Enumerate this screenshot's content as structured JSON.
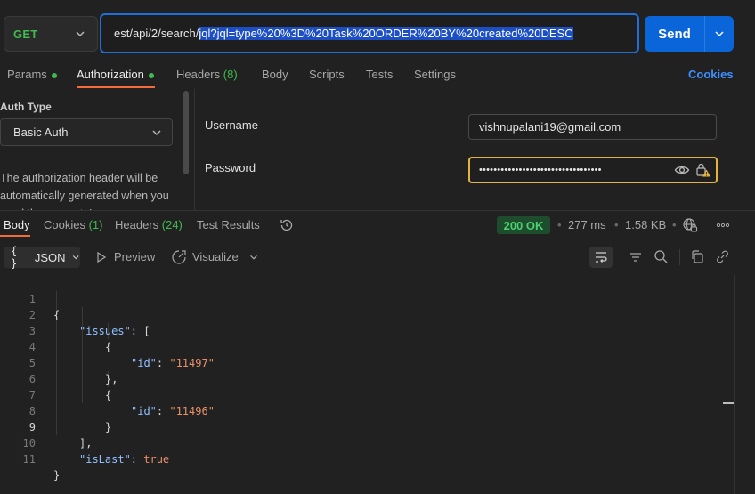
{
  "request": {
    "method": "GET",
    "url_prefix": "est/api/2/search/",
    "url_selected": "jql?jql=type%20%3D%20Task%20ORDER%20BY%20created%20DESC",
    "send_label": "Send"
  },
  "request_tabs": {
    "params": "Params",
    "authorization": "Authorization",
    "headers": "Headers",
    "headers_count": "(8)",
    "body": "Body",
    "scripts": "Scripts",
    "tests": "Tests",
    "settings": "Settings",
    "cookies": "Cookies"
  },
  "auth": {
    "type_label": "Auth Type",
    "type_value": "Basic Auth",
    "description": "The authorization header will be automatically generated when you send the request. Learn more",
    "username_label": "Username",
    "username_value": "vishnupalani19@gmail.com",
    "password_label": "Password",
    "password_value": "••••••••••••••••••••••••••••••••••"
  },
  "response_tabs": {
    "body": "Body",
    "cookies": "Cookies",
    "cookies_count": "(1)",
    "headers": "Headers",
    "headers_count": "(24)",
    "test_results": "Test Results"
  },
  "response_meta": {
    "status": "200 OK",
    "time": "277 ms",
    "size": "1.58 KB"
  },
  "body_toolbar": {
    "format": "JSON",
    "preview": "Preview",
    "visualize": "Visualize"
  },
  "code": {
    "line_numbers": [
      "1",
      "2",
      "3",
      "4",
      "5",
      "6",
      "7",
      "8",
      "9",
      "10",
      "11"
    ],
    "open_brace": "{",
    "close_brace": "}",
    "issues_key": "\"issues\"",
    "array_open": ": [",
    "obj_open": "{",
    "obj_close_comma": "},",
    "obj_close": "}",
    "id_key": "\"id\"",
    "colon": ": ",
    "id_1": "\"11497\"",
    "id_2": "\"11496\"",
    "array_close": "],",
    "islast_key": "\"isLast\"",
    "islast_value": "true"
  },
  "colors": {
    "accent": "#0a66d8",
    "tab_underline": "#f26b3a",
    "status_green": "#4cd070",
    "password_focus": "#e2b341"
  }
}
